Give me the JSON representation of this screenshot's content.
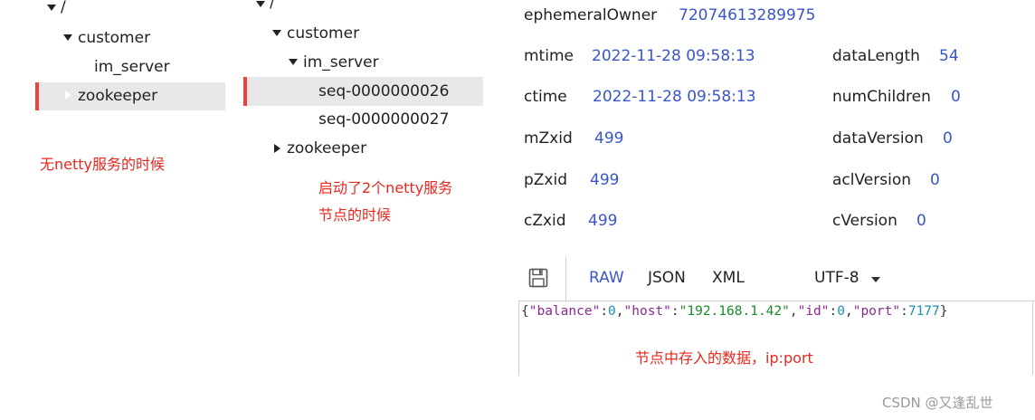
{
  "left_tree": {
    "root": "/",
    "customer": "customer",
    "im_server": "im_server",
    "zookeeper": "zookeeper",
    "note": "无netty服务的时候"
  },
  "mid_tree": {
    "root": "/",
    "customer": "customer",
    "im_server": "im_server",
    "seq1": "seq-0000000026",
    "seq2": "seq-0000000027",
    "zookeeper": "zookeeper",
    "note_line1": "启动了2个netty服务",
    "note_line2": "节点的时候"
  },
  "stats": {
    "ephemeralOwner": {
      "label": "ephemeralOwner",
      "value": "72074613289975"
    },
    "mtime": {
      "label": "mtime",
      "value": "2022-11-28 09:58:13"
    },
    "ctime": {
      "label": "ctime",
      "value": "2022-11-28 09:58:13"
    },
    "mZxid": {
      "label": "mZxid",
      "value": "499"
    },
    "pZxid": {
      "label": "pZxid",
      "value": "499"
    },
    "cZxid": {
      "label": "cZxid",
      "value": "499"
    },
    "dataLength": {
      "label": "dataLength",
      "value": "54"
    },
    "numChildren": {
      "label": "numChildren",
      "value": "0"
    },
    "dataVersion": {
      "label": "dataVersion",
      "value": "0"
    },
    "aclVersion": {
      "label": "aclVersion",
      "value": "0"
    },
    "cVersion": {
      "label": "cVersion",
      "value": "0"
    }
  },
  "toolbar": {
    "raw": "RAW",
    "json": "JSON",
    "xml": "XML",
    "encoding": "UTF-8"
  },
  "data_view": {
    "open_brace": "{",
    "k1": "\"balance\"",
    "v1": "0",
    "k2": "\"host\"",
    "v2": "\"192.168.1.42\"",
    "k3": "\"id\"",
    "v3": "0",
    "k4": "\"port\"",
    "v4": "7177",
    "close_brace": "}",
    "colon": ":",
    "comma": ",",
    "note": "节点中存入的数据，ip:port"
  },
  "watermark": "CSDN @又逢乱世",
  "colors": {
    "accent_red": "#e8281e",
    "value_blue": "#3a55c8",
    "selection_bar": "#f0403c"
  }
}
